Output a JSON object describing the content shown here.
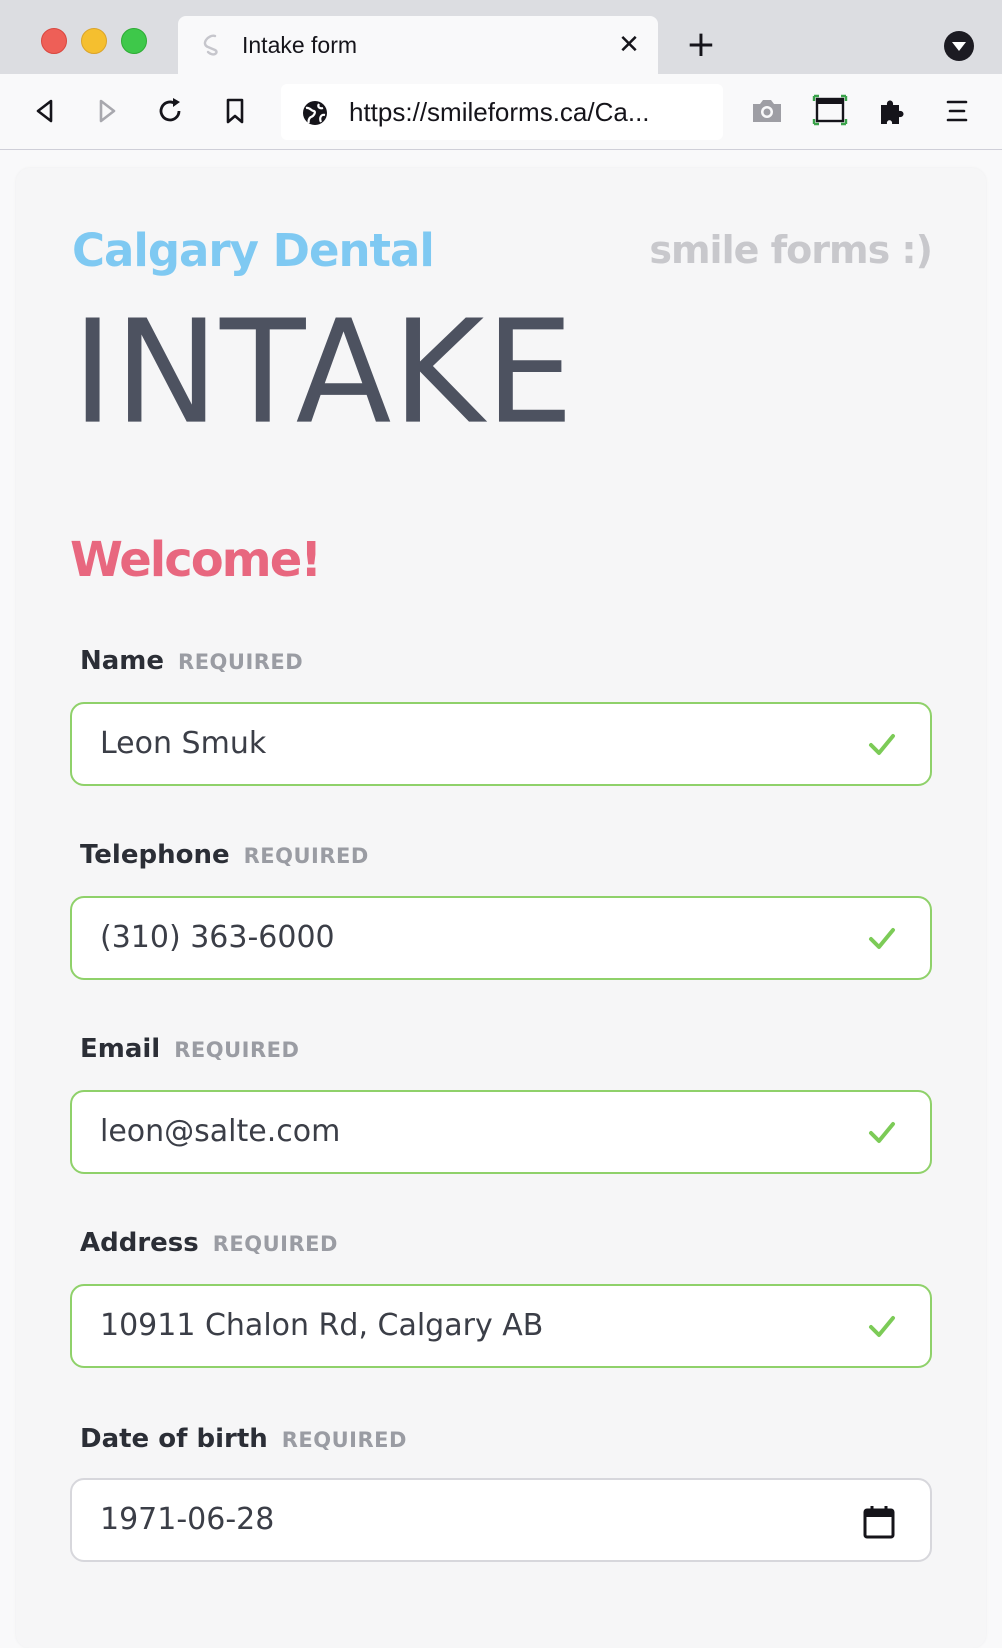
{
  "browser": {
    "tab_title": "Intake form",
    "tab_close_glyph": "✕",
    "new_tab_glyph": "+",
    "url": "https://smileforms.ca/Ca...",
    "icons": [
      "back-icon",
      "forward-icon",
      "reload-icon",
      "bookmark-icon",
      "globe-icon",
      "screenshot-icon",
      "responsive-view-icon",
      "extensions-icon",
      "menu-icon"
    ]
  },
  "header": {
    "clinic_name": "Calgary Dental",
    "product_logo": "smile forms :)",
    "page_title": "INTAKE"
  },
  "form": {
    "greeting": "Welcome!",
    "fields": [
      {
        "label": "Name",
        "required": "REQUIRED",
        "value": "Leon Smuk",
        "status": "valid"
      },
      {
        "label": "Telephone",
        "required": "REQUIRED",
        "value": "(310) 363-6000",
        "status": "valid"
      },
      {
        "label": "Email",
        "required": "REQUIRED",
        "value": "leon@salte.com",
        "status": "valid"
      },
      {
        "label": "Address",
        "required": "REQUIRED",
        "value": "10911 Chalon Rd, Calgary AB",
        "status": "valid"
      },
      {
        "label": "Date of birth",
        "required": "REQUIRED",
        "value": "1971-06-28",
        "status": "date"
      }
    ]
  },
  "colors": {
    "clinic_blue": "#7fc9f2",
    "welcome_pink": "#e8677f",
    "valid_green": "#8fd16a"
  }
}
